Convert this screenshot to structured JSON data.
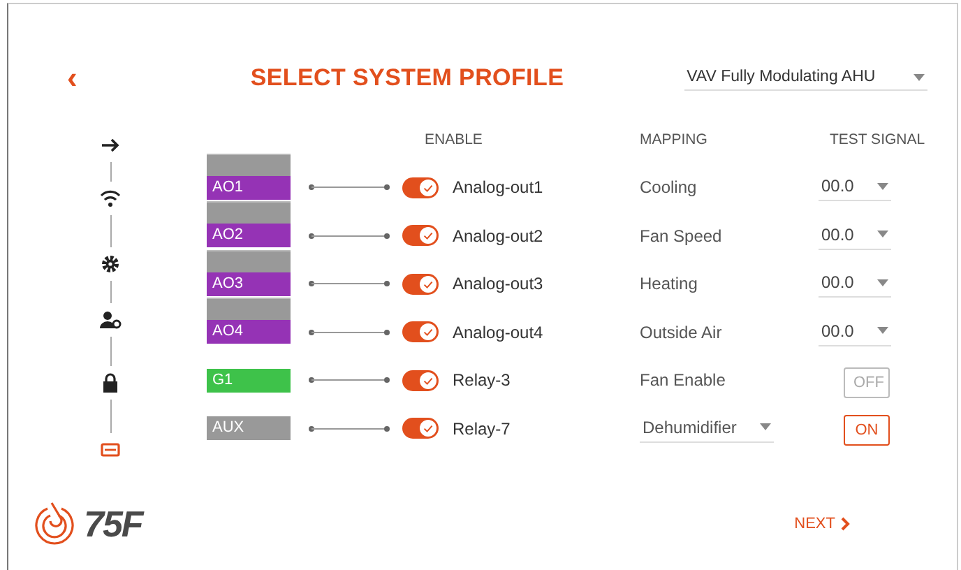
{
  "header": {
    "back": "‹",
    "title": "SELECT SYSTEM PROFILE",
    "profile": "VAV Fully Modulating AHU"
  },
  "steps": [
    {
      "selected": false
    },
    {
      "selected": false
    },
    {
      "selected": false
    },
    {
      "selected": false
    },
    {
      "selected": false
    },
    {
      "selected": true
    }
  ],
  "columns": {
    "enable": "ENABLE",
    "mapping": "MAPPING",
    "test_signal": "TEST SIGNAL"
  },
  "rows": [
    {
      "terminal": "AO1",
      "kind": "analog",
      "color": "#9533b5",
      "enabled": true,
      "output": "Analog-out1",
      "mapping": {
        "kind": "text",
        "label": "Cooling"
      },
      "test": {
        "kind": "dropdown",
        "value": "00.0"
      }
    },
    {
      "terminal": "AO2",
      "kind": "analog",
      "color": "#9533b5",
      "enabled": true,
      "output": "Analog-out2",
      "mapping": {
        "kind": "text",
        "label": "Fan Speed"
      },
      "test": {
        "kind": "dropdown",
        "value": "00.0"
      }
    },
    {
      "terminal": "AO3",
      "kind": "analog",
      "color": "#9533b5",
      "enabled": true,
      "output": "Analog-out3",
      "mapping": {
        "kind": "text",
        "label": "Heating"
      },
      "test": {
        "kind": "dropdown",
        "value": "00.0"
      }
    },
    {
      "terminal": "AO4",
      "kind": "analog",
      "color": "#9533b5",
      "enabled": true,
      "output": "Analog-out4",
      "mapping": {
        "kind": "text",
        "label": "Outside Air"
      },
      "test": {
        "kind": "dropdown",
        "value": "00.0"
      }
    },
    {
      "terminal": "G1",
      "kind": "relay",
      "color": "#3ec24a",
      "enabled": true,
      "output": "Relay-3",
      "mapping": {
        "kind": "text",
        "label": "Fan Enable"
      },
      "test": {
        "kind": "button",
        "label": "OFF",
        "on": false
      }
    },
    {
      "terminal": "AUX",
      "kind": "relay",
      "color": "#999999",
      "enabled": true,
      "output": "Relay-7",
      "mapping": {
        "kind": "dropdown",
        "label": "Dehumidifier"
      },
      "test": {
        "kind": "button",
        "label": "ON",
        "on": true
      }
    }
  ],
  "footer": {
    "logo": "75F",
    "next": "NEXT"
  }
}
